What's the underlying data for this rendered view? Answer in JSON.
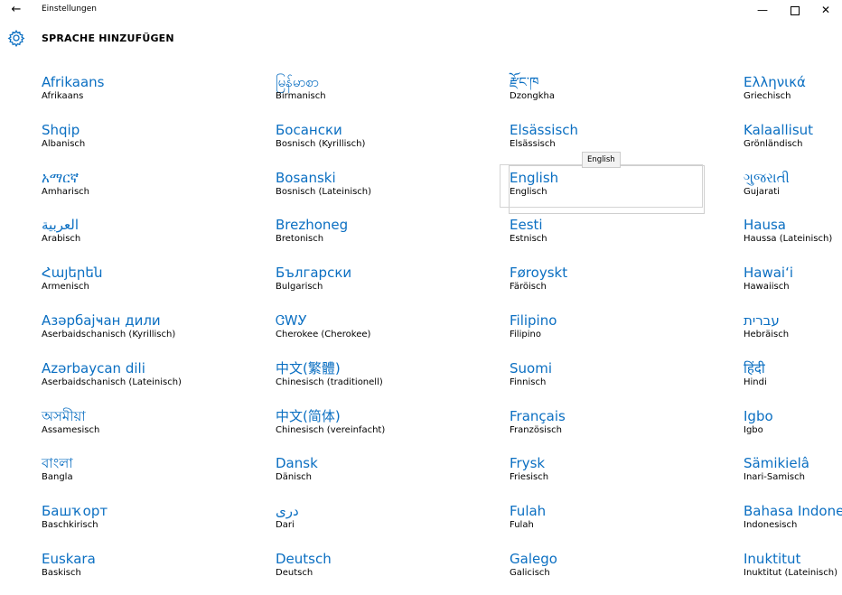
{
  "window": {
    "title": "Einstellungen",
    "back_glyph": "←",
    "minimize_glyph": "—",
    "close_glyph": "✕"
  },
  "header": {
    "title": "SPRACHE HINZUFÜGEN",
    "icon": "gear-icon"
  },
  "colors": {
    "accent": "#0b6fc2",
    "background": "#ffffff",
    "text": "#000000"
  },
  "tooltip": "English",
  "columns": [
    [
      {
        "native": "Afrikaans",
        "german": "Afrikaans"
      },
      {
        "native": "Shqip",
        "german": "Albanisch"
      },
      {
        "native": "አማርኛ",
        "german": "Amharisch"
      },
      {
        "native": "العربية",
        "german": "Arabisch"
      },
      {
        "native": "Հայերեն",
        "german": "Armenisch"
      },
      {
        "native": "Азәрбајҹан дили",
        "german": "Aserbaidschanisch (Kyrillisch)"
      },
      {
        "native": "Azərbaycan dili",
        "german": "Aserbaidschanisch (Lateinisch)"
      },
      {
        "native": "অসমীয়া",
        "german": "Assamesisch"
      },
      {
        "native": "বাংলা",
        "german": "Bangla"
      },
      {
        "native": "Башҡорт",
        "german": "Baschkirisch"
      },
      {
        "native": "Euskara",
        "german": "Baskisch"
      }
    ],
    [
      {
        "native": "မြန်မာစာ",
        "german": "Birmanisch"
      },
      {
        "native": "Босански",
        "german": "Bosnisch (Kyrillisch)"
      },
      {
        "native": "Bosanski",
        "german": "Bosnisch (Lateinisch)"
      },
      {
        "native": "Brezhoneg",
        "german": "Bretonisch"
      },
      {
        "native": "Български",
        "german": "Bulgarisch"
      },
      {
        "native": "ᏣᎳᎩ",
        "german": "Cherokee (Cherokee)"
      },
      {
        "native": "中文(繁體)",
        "german": "Chinesisch (traditionell)"
      },
      {
        "native": "中文(简体)",
        "german": "Chinesisch (vereinfacht)"
      },
      {
        "native": "Dansk",
        "german": "Dänisch"
      },
      {
        "native": "دری",
        "german": "Dari"
      },
      {
        "native": "Deutsch",
        "german": "Deutsch"
      }
    ],
    [
      {
        "native": "རྫོང་ཁ",
        "german": "Dzongkha"
      },
      {
        "native": "Elsässisch",
        "german": "Elsässisch"
      },
      {
        "native": "English",
        "german": "Englisch"
      },
      {
        "native": "Eesti",
        "german": "Estnisch"
      },
      {
        "native": "Føroyskt",
        "german": "Färöisch"
      },
      {
        "native": "Filipino",
        "german": "Filipino"
      },
      {
        "native": "Suomi",
        "german": "Finnisch"
      },
      {
        "native": "Français",
        "german": "Französisch"
      },
      {
        "native": "Frysk",
        "german": "Friesisch"
      },
      {
        "native": "Fulah",
        "german": "Fulah"
      },
      {
        "native": "Galego",
        "german": "Galicisch"
      }
    ],
    [
      {
        "native": "Ελληνικά",
        "german": "Griechisch"
      },
      {
        "native": "Kalaallisut",
        "german": "Grönländisch"
      },
      {
        "native": "ગુજરાતી",
        "german": "Gujarati"
      },
      {
        "native": "Hausa",
        "german": "Haussa (Lateinisch)"
      },
      {
        "native": "Hawaiʻi",
        "german": "Hawaiisch"
      },
      {
        "native": "עברית",
        "german": "Hebräisch"
      },
      {
        "native": "हिंदी",
        "german": "Hindi"
      },
      {
        "native": "Igbo",
        "german": "Igbo"
      },
      {
        "native": "Sämikielâ",
        "german": "Inari-Samisch"
      },
      {
        "native": "Bahasa Indonesia",
        "german": "Indonesisch"
      },
      {
        "native": "Inuktitut",
        "german": "Inuktitut (Lateinisch)"
      }
    ]
  ]
}
